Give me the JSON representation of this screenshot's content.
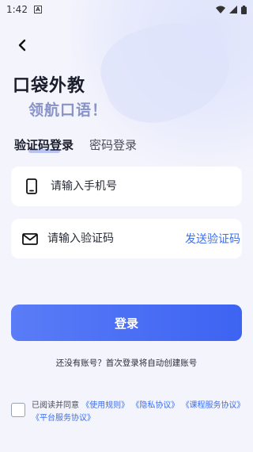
{
  "status_bar": {
    "time": "1:42",
    "notif": "A"
  },
  "brand": {
    "name": "口袋外教",
    "slogan": "领航口语！"
  },
  "tabs": [
    {
      "label": "验证码登录",
      "active": true
    },
    {
      "label": "密码登录",
      "active": false
    }
  ],
  "phone_field": {
    "placeholder": "请输入手机号",
    "value": ""
  },
  "code_field": {
    "placeholder": "请输入验证码",
    "value": "",
    "send_label": "发送验证码"
  },
  "login_button": {
    "label": "登录"
  },
  "hint": "还没有账号？首次登录将自动创建账号",
  "agreement": {
    "prefix": "已阅读并同意",
    "links": [
      "《使用规则》",
      "《隐私协议》",
      "《课程服务协议》",
      "《平台服务协议》"
    ]
  },
  "colors": {
    "accent": "#3d6ff0",
    "button_start": "#5a7cf7",
    "button_end": "#3d63f2",
    "slogan": "#8a93c8"
  }
}
